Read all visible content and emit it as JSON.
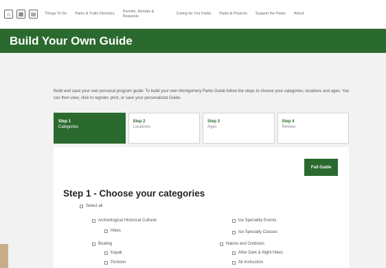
{
  "nav": {
    "icons": [
      "home-icon",
      "calendar-icon",
      "grid-icon"
    ],
    "links": [
      "Things To Do",
      "Parks & Trails Directory",
      "Permits, Rentals & Requests",
      "Caring for Our Parks",
      "Parks & Projects",
      "Support the Parks",
      "About"
    ]
  },
  "banner": {
    "title": "Build Your Own Guide"
  },
  "intro": "Build and save your own personal program guide: To build your own Montgomery Parks Guide follow the steps to choose your categories, locations and ages. You can then view, click to register, print, or save your personalized Guide.",
  "steps": [
    {
      "number": "Step 1",
      "name": "Categories",
      "active": true
    },
    {
      "number": "Step 2",
      "name": "Locations",
      "active": false
    },
    {
      "number": "Step 3",
      "name": "Ages",
      "active": false
    },
    {
      "number": "Step 4",
      "name": "Review",
      "active": false
    }
  ],
  "card": {
    "full_guide_label": "Full Guide",
    "heading": "Step 1 - Choose your categories",
    "select_all": "Select all",
    "categories": {
      "archeological": "Archeological Historical Cultural",
      "hikes": "Hikes",
      "boating": "Boating",
      "kayak": "Kayak",
      "pontoon": "Pontoon",
      "ice_events": "Ice Speciality Events",
      "ice_classes": "Ice Specialty Classes",
      "nature": "Nature and Outdoors",
      "after_dark": "After Dark & Night Hikes",
      "all_instruction": "All Instruction"
    }
  },
  "colors": {
    "brand_green": "#2b6a2f",
    "accent_tan": "#c9ad88"
  }
}
